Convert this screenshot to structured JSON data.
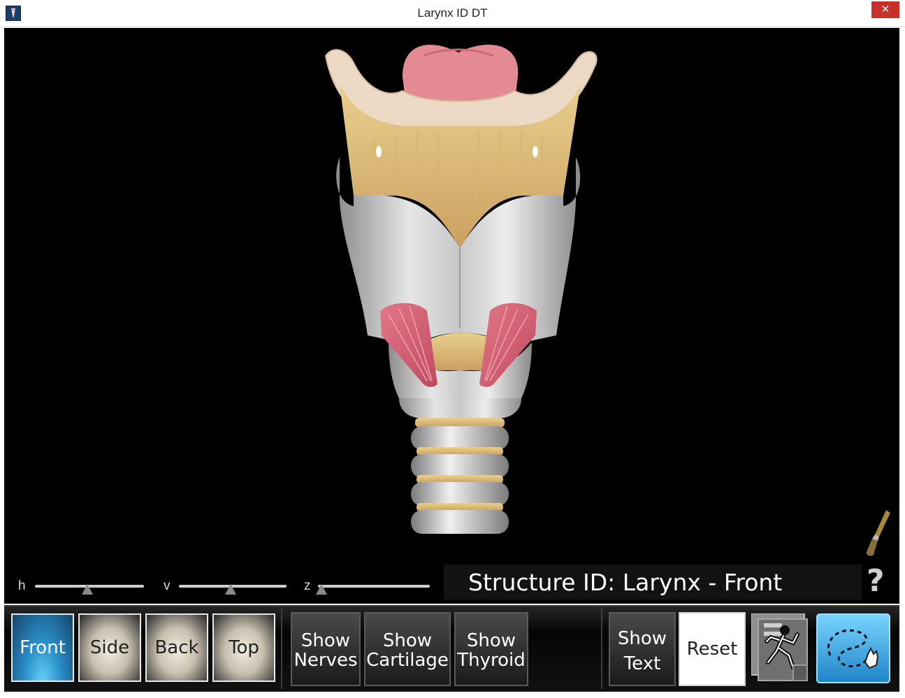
{
  "window": {
    "title": "Larynx ID DT",
    "close_glyph": "✕",
    "icon": "app-logo-icon"
  },
  "sliders": [
    {
      "label": "h",
      "value": 0.48
    },
    {
      "label": "v",
      "value": 0.48
    },
    {
      "label": "z",
      "value": 0.03
    }
  ],
  "structure": {
    "text": "Structure ID: Larynx - Front"
  },
  "help": {
    "glyph": "?"
  },
  "view_buttons": [
    {
      "label": "Front",
      "active": true
    },
    {
      "label": "Side",
      "active": false
    },
    {
      "label": "Back",
      "active": false
    },
    {
      "label": "Top",
      "active": false
    }
  ],
  "option_buttons": [
    {
      "line1": "Show",
      "line2": "Nerves"
    },
    {
      "line1": "Show",
      "line2": "Cartilage"
    },
    {
      "line1": "Show",
      "line2": "Thyroid"
    }
  ],
  "text_button": {
    "line1": "Show",
    "line2": "Text"
  },
  "reset_button": {
    "label": "Reset"
  },
  "icons": {
    "brush": "paintbrush-icon",
    "quiz": "quiz-runner-icon",
    "trace": "trace-path-hand-icon"
  },
  "colors": {
    "viewport_bg": "#000000",
    "active_blue": "#2a8ec8",
    "close_red": "#c8302c"
  }
}
